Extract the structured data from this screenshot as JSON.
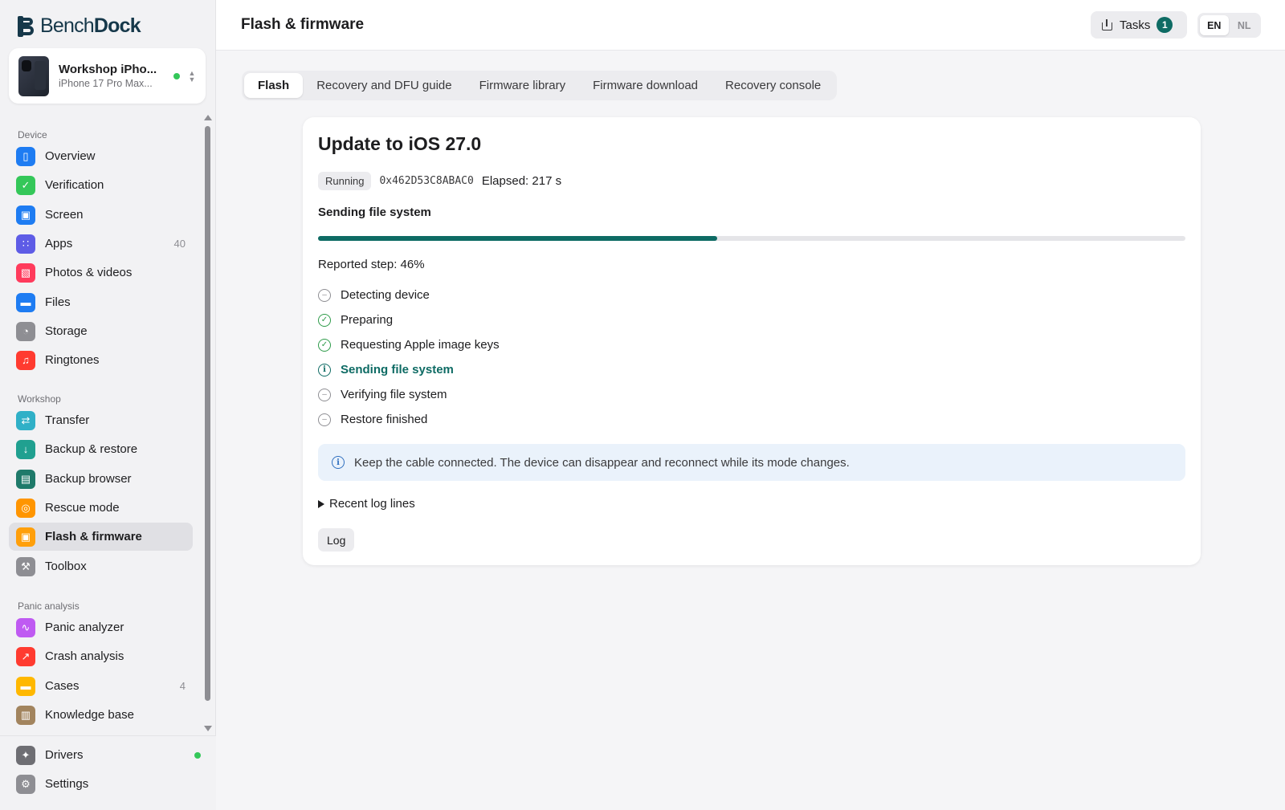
{
  "app": {
    "brand_part1": "Bench",
    "brand_part2": "Dock"
  },
  "device": {
    "name": "Workshop iPho...",
    "model": "iPhone 17 Pro Max...",
    "status_color": "#34c759"
  },
  "sidebar": {
    "sections": [
      {
        "label": "Device",
        "items": [
          {
            "label": "Overview",
            "icon": "phone-icon",
            "color": "#1e7cf2"
          },
          {
            "label": "Verification",
            "icon": "shield-check-icon",
            "color": "#34c759"
          },
          {
            "label": "Screen",
            "icon": "screen-icon",
            "color": "#1e7cf2"
          },
          {
            "label": "Apps",
            "icon": "apps-grid-icon",
            "color": "#5e5ce6",
            "count": "40"
          },
          {
            "label": "Photos & videos",
            "icon": "photos-icon",
            "color": "#ff3b5c"
          },
          {
            "label": "Files",
            "icon": "folder-icon",
            "color": "#1e7cf2"
          },
          {
            "label": "Storage",
            "icon": "storage-pie-icon",
            "color": "#8e8e93"
          },
          {
            "label": "Ringtones",
            "icon": "music-note-icon",
            "color": "#ff3b30"
          }
        ]
      },
      {
        "label": "Workshop",
        "items": [
          {
            "label": "Transfer",
            "icon": "transfer-arrows-icon",
            "color": "#30b0c7"
          },
          {
            "label": "Backup & restore",
            "icon": "backup-box-icon",
            "color": "#20a090"
          },
          {
            "label": "Backup browser",
            "icon": "archive-icon",
            "color": "#1f7a6a"
          },
          {
            "label": "Rescue mode",
            "icon": "lifebuoy-icon",
            "color": "#ff9500"
          },
          {
            "label": "Flash & firmware",
            "icon": "chip-icon",
            "color": "#ff9f0a",
            "active": true
          },
          {
            "label": "Toolbox",
            "icon": "wrench-icon",
            "color": "#8e8e93"
          }
        ]
      },
      {
        "label": "Panic analysis",
        "items": [
          {
            "label": "Panic analyzer",
            "icon": "waveform-icon",
            "color": "#bf5af2"
          },
          {
            "label": "Crash analysis",
            "icon": "trend-chart-icon",
            "color": "#ff3b30"
          },
          {
            "label": "Cases",
            "icon": "case-folder-icon",
            "color": "#ffb800",
            "count": "4"
          },
          {
            "label": "Knowledge base",
            "icon": "book-icon",
            "color": "#a2845e"
          }
        ]
      }
    ],
    "footer": [
      {
        "label": "Drivers",
        "icon": "puzzle-icon",
        "color": "#6e6e73",
        "status": "#34c759"
      },
      {
        "label": "Settings",
        "icon": "gear-icon",
        "color": "#8e8e93"
      }
    ]
  },
  "header": {
    "title": "Flash & firmware",
    "tasks_label": "Tasks",
    "tasks_count": "1",
    "languages": [
      "EN",
      "NL"
    ],
    "active_language": "EN"
  },
  "tabs": [
    "Flash",
    "Recovery and DFU guide",
    "Firmware library",
    "Firmware download",
    "Recovery console"
  ],
  "active_tab": "Flash",
  "flash": {
    "title": "Update to iOS 27.0",
    "status_badge": "Running",
    "ecid": "0x462D53C8ABAC0",
    "elapsed": "Elapsed: 217 s",
    "current_step_heading": "Sending file system",
    "progress_fraction": 0.46,
    "reported_step": "Reported step: 46%",
    "steps": [
      {
        "label": "Detecting device",
        "state": "pending"
      },
      {
        "label": "Preparing",
        "state": "done"
      },
      {
        "label": "Requesting Apple image keys",
        "state": "done"
      },
      {
        "label": "Sending file system",
        "state": "current"
      },
      {
        "label": "Verifying file system",
        "state": "pending"
      },
      {
        "label": "Restore finished",
        "state": "pending"
      }
    ],
    "notice": "Keep the cable connected. The device can disappear and reconnect while its mode changes.",
    "log_toggle": "Recent log lines",
    "log_button": "Log"
  },
  "colors": {
    "accent": "#0e6b64",
    "success": "#2e9b4a",
    "info": "#2f6fbf"
  }
}
